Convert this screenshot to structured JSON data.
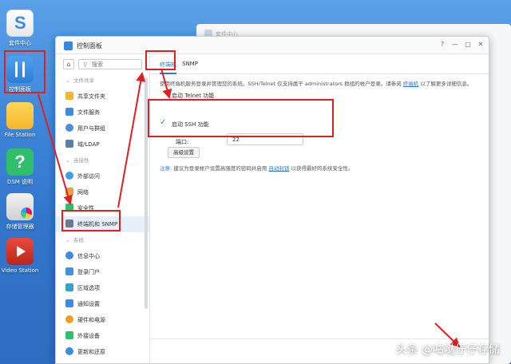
{
  "desktop": {
    "icons": [
      {
        "label": "套件中心"
      },
      {
        "label": "控制面板"
      },
      {
        "label": "File Station"
      },
      {
        "label": "DSM 说明"
      },
      {
        "label": "存储管理器"
      },
      {
        "label": "Video Station"
      }
    ]
  },
  "background_window": {
    "title": "套件中心"
  },
  "window": {
    "title": "控制面板",
    "controls": [
      "?",
      "—",
      "□",
      "✕"
    ]
  },
  "sidebar": {
    "search_placeholder": "搜索",
    "sections": [
      {
        "header": "文件共享",
        "items": [
          "共享文件夹",
          "文件服务",
          "用户与群组",
          "域/LDAP"
        ]
      },
      {
        "header": "连接性",
        "items": [
          "外部访问",
          "网络",
          "安全性",
          "终端机和 SNMP"
        ]
      },
      {
        "header": "系统",
        "items": [
          "信息中心",
          "登录门户",
          "区域选项",
          "通知设置",
          "硬件和电源",
          "外接设备",
          "更新和还原"
        ]
      }
    ],
    "active_item": "终端机和 SNMP"
  },
  "content": {
    "tabs": [
      "终端机",
      "SNMP"
    ],
    "active_tab": "终端机",
    "description_prefix": "使用终端机服务登录并管理您的系统。SSH/Telnet 仅支持属于 administrators 群组的帐户登录。请参阅",
    "description_link": "终端机",
    "description_suffix": "以了解更多详细信息。",
    "telnet_label": "启动 Telnet 功能",
    "telnet_checked": false,
    "ssh_label": "启动 SSH 功能",
    "ssh_checked": true,
    "port_label": "端口:",
    "port_value": "22",
    "advanced_button": "高级设置",
    "note_label": "注意:",
    "note_prefix": "建议为登录帐户设置高强度的密码并启用",
    "note_link": "自动封锁",
    "note_suffix": "以获得最好的系统安全性。"
  },
  "watermark": "头条 @咕哒仔仔存储",
  "colors": {
    "accent": "#2d7ad6",
    "annotation": "#e02020",
    "desktop_bg": "#3d85d9"
  }
}
